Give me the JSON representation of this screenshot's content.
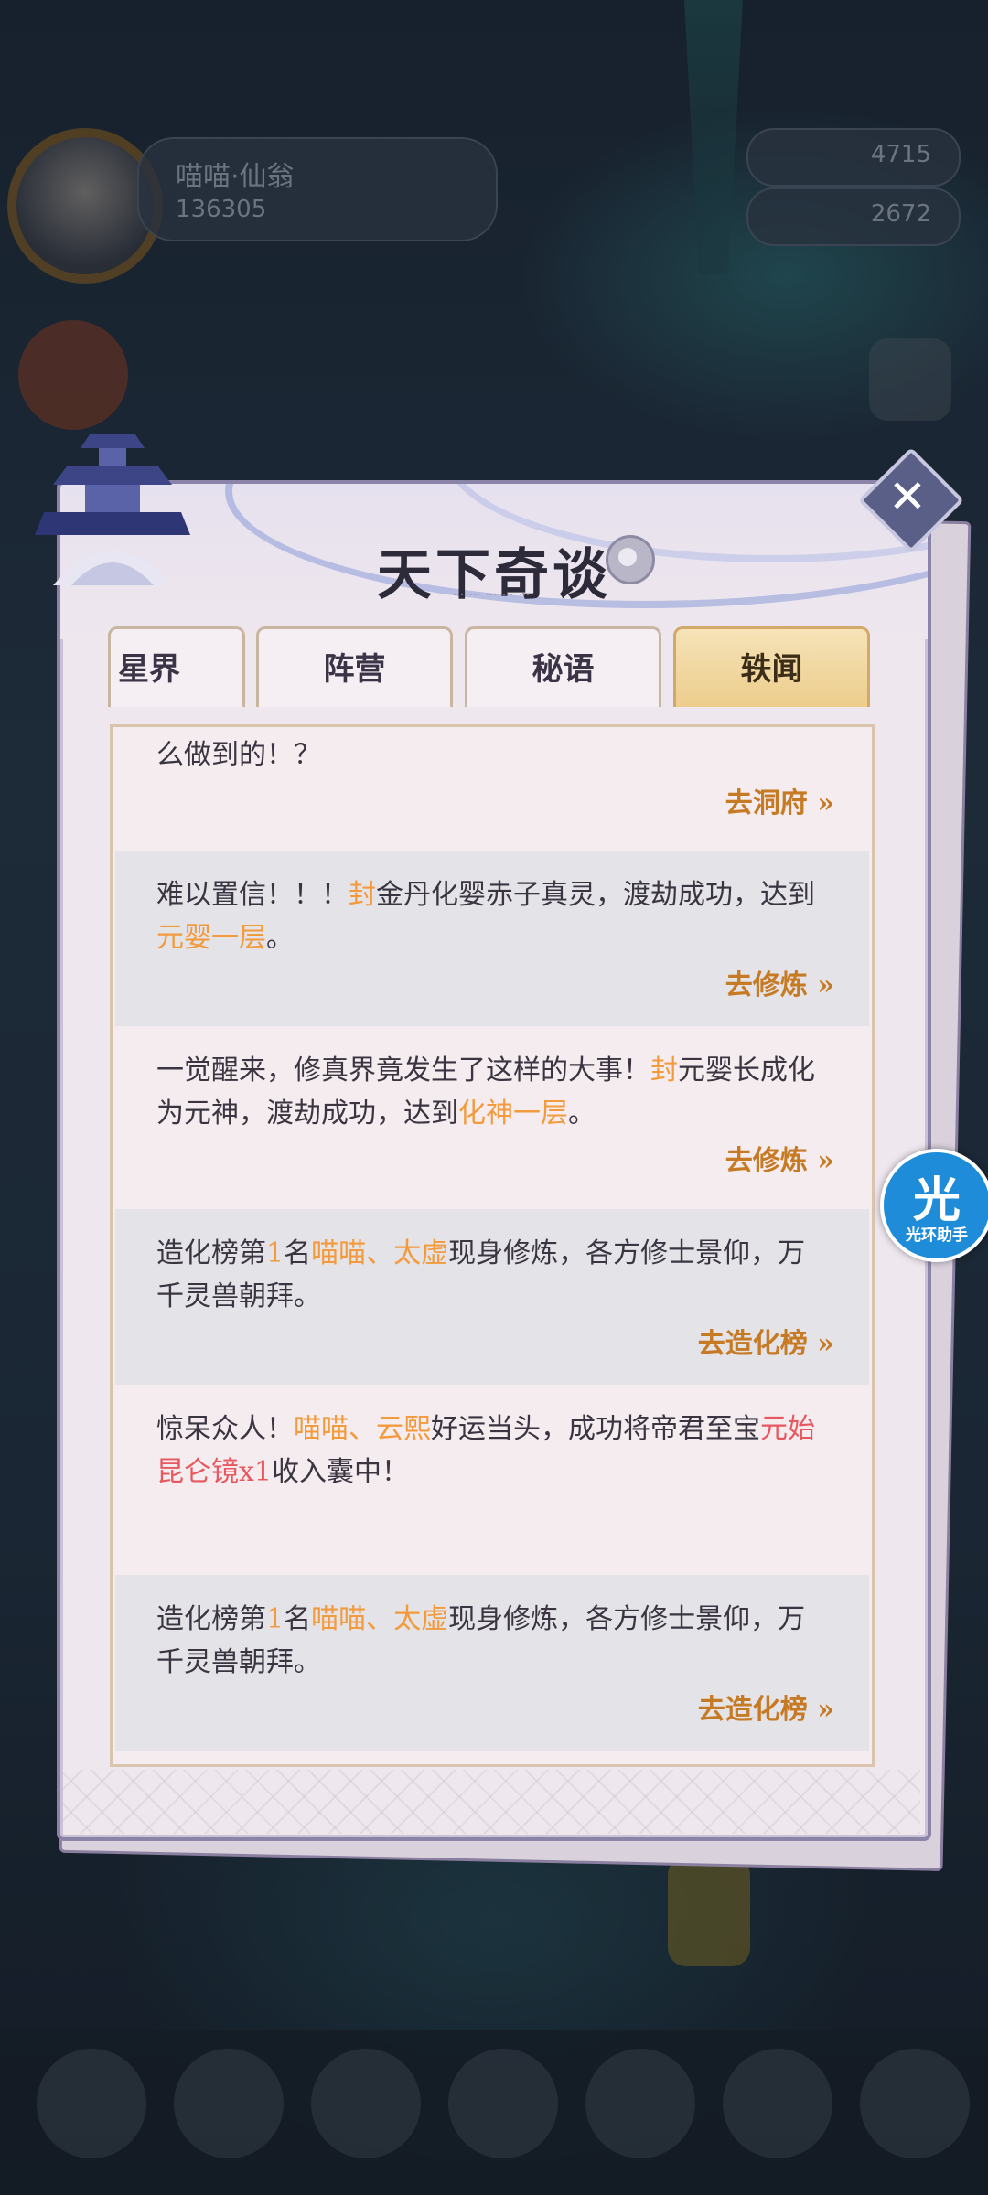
{
  "hud": {
    "player_name": "喵喵·仙翁",
    "power": "136305",
    "resource_1": "4715",
    "resource_2": "2672"
  },
  "modal": {
    "title": "天下奇谈",
    "subtitle": "……………",
    "close_icon": "close-icon",
    "info_icon": "gear-icon"
  },
  "tabs": [
    {
      "label": "星界",
      "active": false
    },
    {
      "label": "阵营",
      "active": false
    },
    {
      "label": "秘语",
      "active": false
    },
    {
      "label": "轶闻",
      "active": true
    }
  ],
  "items": [
    {
      "segments": [
        {
          "t": "么做到的！？",
          "c": ""
        }
      ],
      "link": "去洞府 »"
    },
    {
      "segments": [
        {
          "t": "难以置信！！！",
          "c": ""
        },
        {
          "t": "封",
          "c": "hl"
        },
        {
          "t": "金丹化婴赤子真灵，渡劫成功，达到",
          "c": ""
        },
        {
          "t": "元婴一层",
          "c": "hl"
        },
        {
          "t": "。",
          "c": ""
        }
      ],
      "link": "去修炼 »"
    },
    {
      "segments": [
        {
          "t": "一觉醒来，修真界竟发生了这样的大事！",
          "c": ""
        },
        {
          "t": "封",
          "c": "hl"
        },
        {
          "t": "元婴长成化为元神，渡劫成功，达到",
          "c": ""
        },
        {
          "t": "化神一层",
          "c": "hl"
        },
        {
          "t": "。",
          "c": ""
        }
      ],
      "link": "去修炼 »"
    },
    {
      "segments": [
        {
          "t": "造化榜第",
          "c": ""
        },
        {
          "t": "1",
          "c": "hl"
        },
        {
          "t": "名",
          "c": ""
        },
        {
          "t": "喵喵、太虚",
          "c": "hl"
        },
        {
          "t": "现身修炼，各方修士景仰，万千灵兽朝拜。",
          "c": ""
        }
      ],
      "link": "去造化榜 »"
    },
    {
      "segments": [
        {
          "t": "惊呆众人！",
          "c": ""
        },
        {
          "t": "喵喵、云熙",
          "c": "hl"
        },
        {
          "t": "好运当头，成功将帝君至宝",
          "c": ""
        },
        {
          "t": "元始昆仑镜x1",
          "c": "red"
        },
        {
          "t": "收入囊中！",
          "c": ""
        }
      ],
      "link": ""
    },
    {
      "segments": [
        {
          "t": "造化榜第",
          "c": ""
        },
        {
          "t": "1",
          "c": "hl"
        },
        {
          "t": "名",
          "c": ""
        },
        {
          "t": "喵喵、太虚",
          "c": "hl"
        },
        {
          "t": "现身修炼，各方修士景仰，万千灵兽朝拜。",
          "c": ""
        }
      ],
      "link": "去造化榜 »"
    }
  ],
  "helper": {
    "big": "光",
    "small": "光环助手"
  },
  "colors": {
    "highlight": "#f39a3c",
    "red": "#e8565e",
    "link": "#c77a24",
    "active_tab": "#eccd8c"
  }
}
